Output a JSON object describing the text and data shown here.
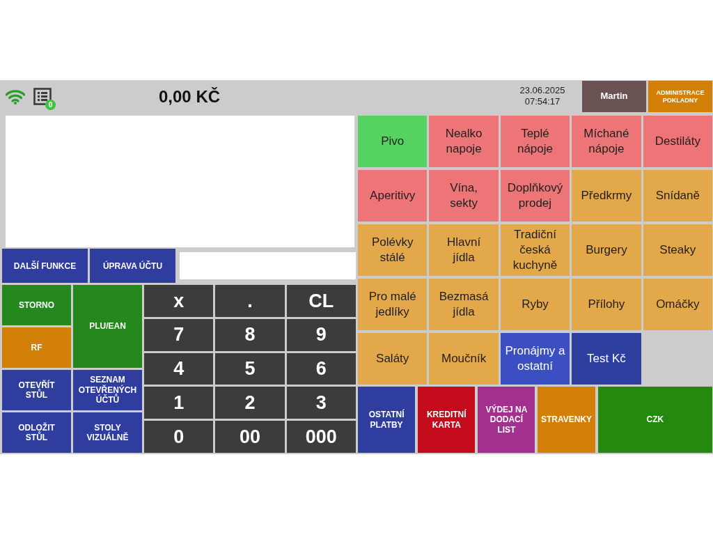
{
  "header": {
    "order_count": "0",
    "total": "0,00 KČ",
    "date": "23.06.2025",
    "time": "07:54:17",
    "user_button": "Martin",
    "admin_button": "ADMINISTRACE\nPOKLADNY"
  },
  "function_buttons": [
    {
      "label": "DALŠÍ FUNKCE"
    },
    {
      "label": "ÚPRAVA ÚČTU"
    }
  ],
  "actions": [
    {
      "label": "STORNO",
      "color": "#24881c"
    },
    {
      "label": "PLU/EAN",
      "color": "#24881c"
    },
    {
      "label": "RF",
      "color": "#d28007"
    },
    {
      "label": "OTEVŘÍT\nSTŮL",
      "color": "#2f3d9e"
    },
    {
      "label": "SEZNAM\nOTEVŘENÝCH\nÚČTŮ",
      "color": "#2f3d9e"
    },
    {
      "label": "ODLOŽIT\nSTŮL",
      "color": "#2f3d9e"
    },
    {
      "label": "STOLY\nVIZUÁLNĚ",
      "color": "#2f3d9e"
    }
  ],
  "keypad": [
    "x",
    ".",
    "CL",
    "7",
    "8",
    "9",
    "4",
    "5",
    "6",
    "1",
    "2",
    "3",
    "0",
    "00",
    "000"
  ],
  "categories": [
    {
      "label": "Pivo",
      "color": "#55d25f"
    },
    {
      "label": "Nealko\nnapoje",
      "color": "#ee7577"
    },
    {
      "label": "Teplé\nnápoje",
      "color": "#ee7577"
    },
    {
      "label": "Míchané\nnápoje",
      "color": "#ee7577"
    },
    {
      "label": "Destiláty",
      "color": "#ee7577"
    },
    {
      "label": "Aperitivy",
      "color": "#ee7577"
    },
    {
      "label": "Vína,\nsekty",
      "color": "#ee7577"
    },
    {
      "label": "Doplňkový\nprodej",
      "color": "#ee7577"
    },
    {
      "label": "Předkrmy",
      "color": "#e3a84a"
    },
    {
      "label": "Snídaně",
      "color": "#e3a84a"
    },
    {
      "label": "Polévky\nstálé",
      "color": "#e3a84a"
    },
    {
      "label": "Hlavní\njídla",
      "color": "#e3a84a"
    },
    {
      "label": "Tradiční\nčeská\nkuchyně",
      "color": "#e3a84a"
    },
    {
      "label": "Burgery",
      "color": "#e3a84a"
    },
    {
      "label": "Steaky",
      "color": "#e3a84a"
    },
    {
      "label": "Pro malé\njedlíky",
      "color": "#e3a84a"
    },
    {
      "label": "Bezmasá\njídla",
      "color": "#e3a84a"
    },
    {
      "label": "Ryby",
      "color": "#e3a84a"
    },
    {
      "label": "Přílohy",
      "color": "#e3a84a"
    },
    {
      "label": "Omáčky",
      "color": "#e3a84a"
    },
    {
      "label": "Saláty",
      "color": "#e3a84a"
    },
    {
      "label": "Moučník",
      "color": "#e3a84a"
    },
    {
      "label": "Pronájmy a\nostatní",
      "color": "#3b4fc2"
    },
    {
      "label": "Test Kč",
      "color": "#2e3f9f"
    }
  ],
  "payments": [
    {
      "label": "OSTATNÍ\nPLATBY",
      "color": "#2f3d9e"
    },
    {
      "label": "KREDITNÍ\nKARTA",
      "color": "#c30b1b"
    },
    {
      "label": "VÝDEJ NA\nDODACÍ\nLIST",
      "color": "#a1308e"
    },
    {
      "label": "STRAVENKY",
      "color": "#d28007"
    },
    {
      "label": "CZK",
      "color": "#23890f"
    }
  ]
}
